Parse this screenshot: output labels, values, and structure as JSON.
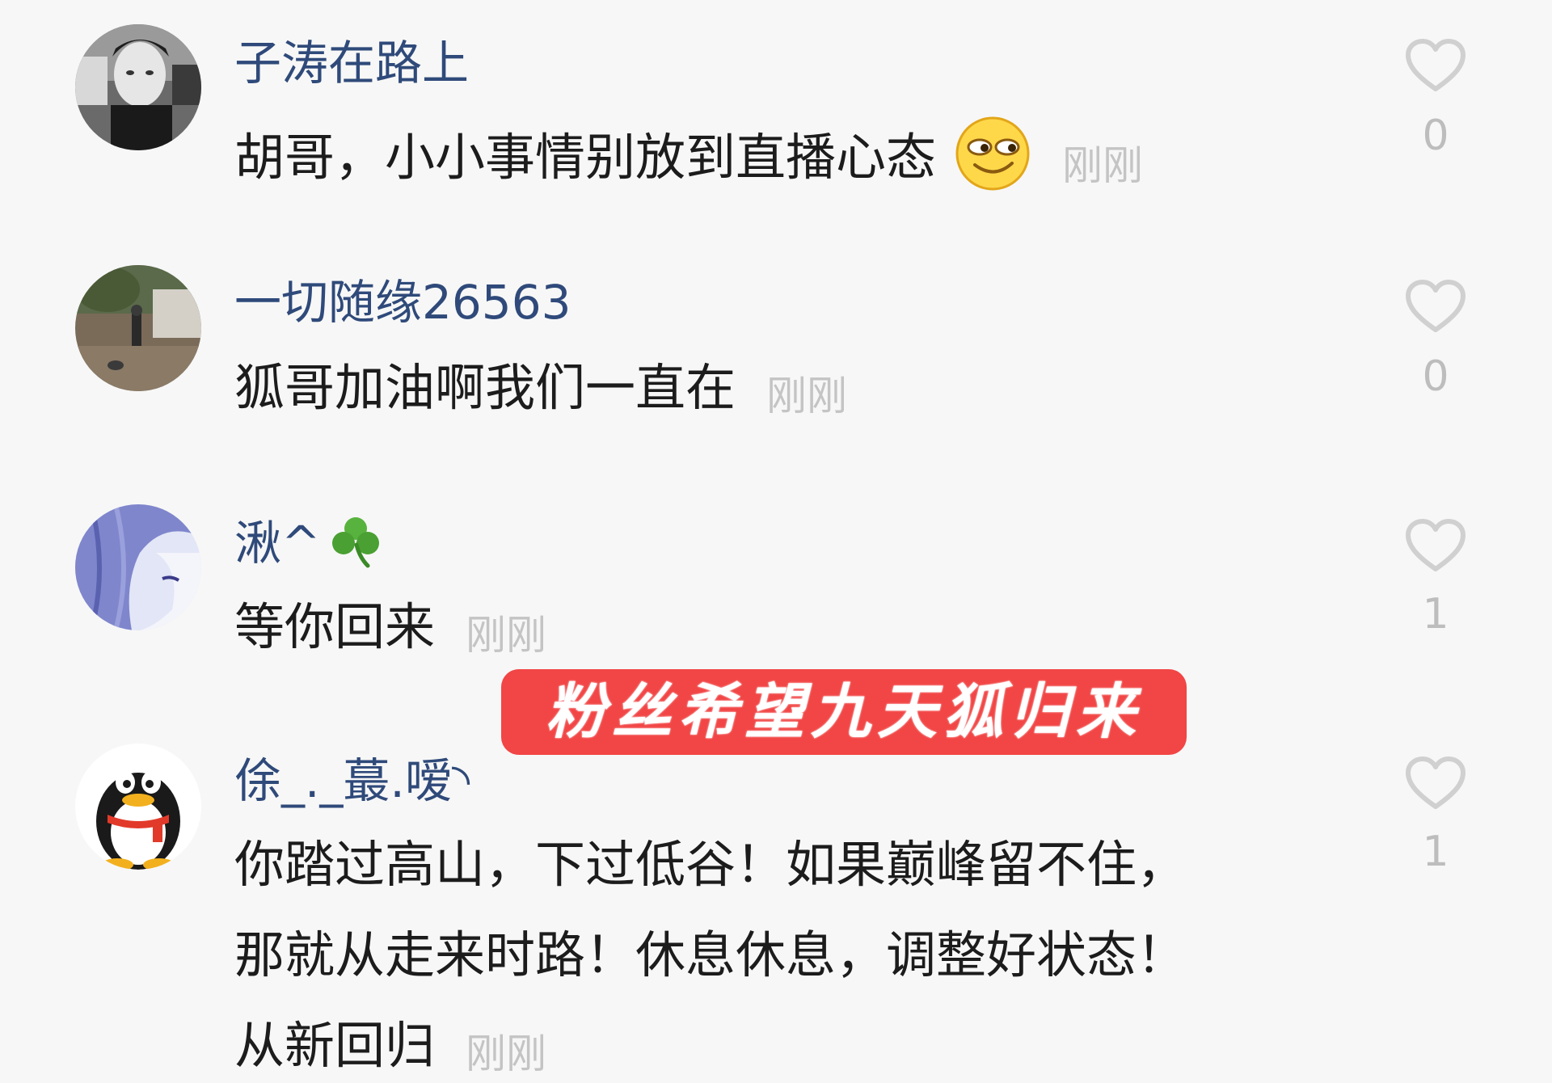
{
  "comments": [
    {
      "username": "子涛在路上",
      "lines": [
        "胡哥，小小事情别放到直播心态"
      ],
      "emoji": "smirk-face-emoji",
      "timestamp": "刚刚",
      "likes": "0"
    },
    {
      "username": "一切随缘26563",
      "lines": [
        "狐哥加油啊我们一直在"
      ],
      "timestamp": "刚刚",
      "likes": "0"
    },
    {
      "username": "湫^",
      "username_emoji": "shamrock-emoji",
      "lines": [
        "等你回来"
      ],
      "timestamp": "刚刚",
      "likes": "1"
    },
    {
      "username": "俆_._蕞.嗳◝",
      "lines": [
        "你踏过高山，下过低谷！如果巅峰留不住，",
        "那就从走来时路！休息休息，调整好状态！",
        "从新回归"
      ],
      "timestamp": "刚刚",
      "likes": "1"
    }
  ],
  "banner": {
    "text": "粉丝希望九天狐归来",
    "background_color": "#f24545"
  },
  "colors": {
    "username": "#2f4a7a",
    "comment_text": "#1c1c1c",
    "timestamp": "#c4c4c4",
    "like_icon": "#d0d0d0"
  },
  "icons": {
    "like": "heart-outline-icon"
  }
}
